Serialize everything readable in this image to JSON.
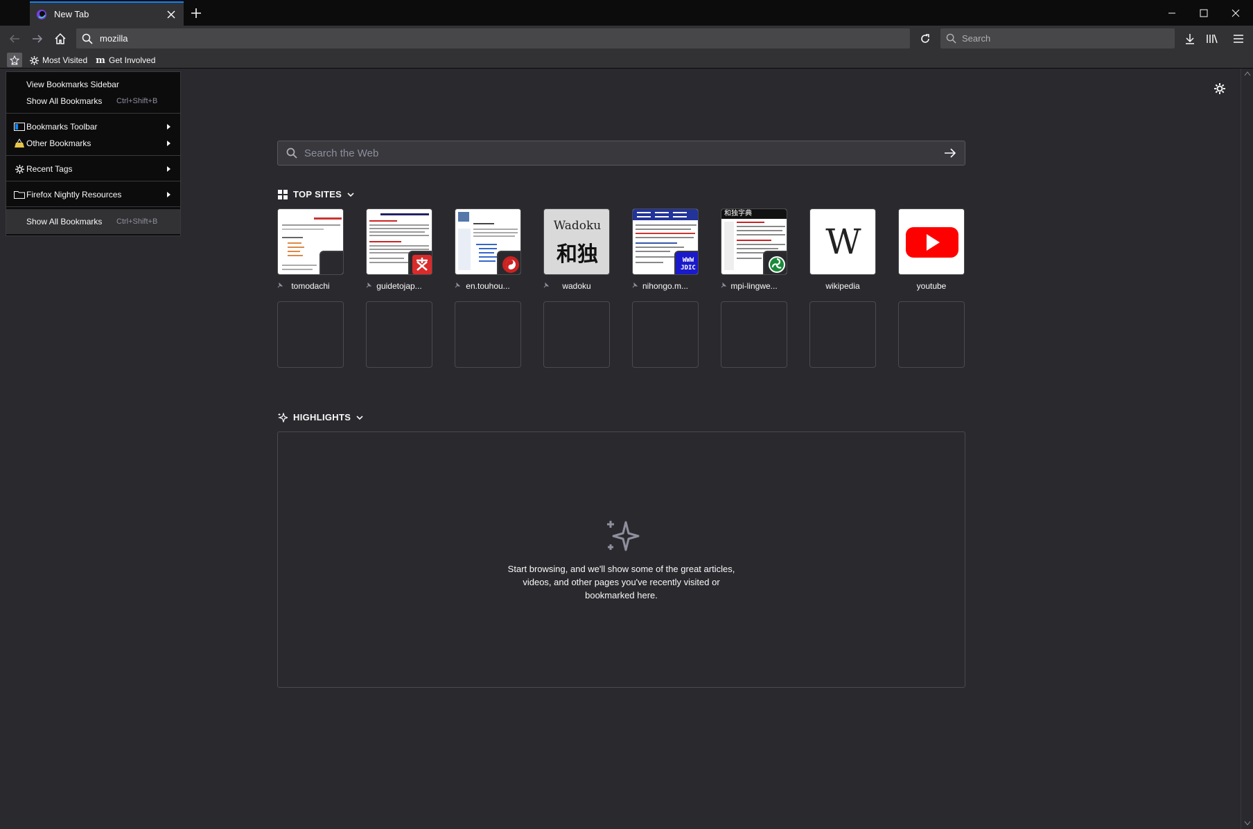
{
  "tab": {
    "title": "New Tab"
  },
  "urlbar": {
    "value": "mozilla"
  },
  "searchbar": {
    "placeholder": "Search"
  },
  "bookmarks_toolbar": {
    "items": [
      {
        "label": "Most Visited",
        "icon": "gear-icon"
      },
      {
        "label": "Get Involved",
        "icon": "mozilla-m-icon"
      }
    ]
  },
  "bookmarks_menu": {
    "view_sidebar": "View Bookmarks Sidebar",
    "show_all_top": "Show All Bookmarks",
    "show_all_top_shortcut": "Ctrl+Shift+B",
    "bookmarks_toolbar": "Bookmarks Toolbar",
    "other_bookmarks": "Other Bookmarks",
    "recent_tags": "Recent Tags",
    "firefox_nightly_resources": "Firefox Nightly Resources",
    "show_all_bottom": "Show All Bookmarks",
    "show_all_bottom_shortcut": "Ctrl+Shift+B"
  },
  "newtab": {
    "search_placeholder": "Search the Web",
    "top_sites_title": "TOP SITES",
    "highlights_title": "HIGHLIGHTS",
    "highlights_empty": "Start browsing, and we'll show some of the great articles, videos, and other pages you've recently visited or bookmarked here.",
    "top_sites": [
      {
        "label": "tomodachi",
        "pinned": true
      },
      {
        "label": "guidetojap...",
        "pinned": true
      },
      {
        "label": "en.touhou...",
        "pinned": true
      },
      {
        "label": "wadoku",
        "pinned": true,
        "thumb_text": "Wadoku",
        "thumb_kanji": "和独"
      },
      {
        "label": "nihongo.m...",
        "pinned": true,
        "badge_text": "WWW JDIC"
      },
      {
        "label": "mpi-lingwe...",
        "pinned": true,
        "thumb_text": "和独字典"
      },
      {
        "label": "wikipedia",
        "pinned": false,
        "thumb_text": "W"
      },
      {
        "label": "youtube",
        "pinned": false
      }
    ]
  },
  "colors": {
    "accent": "#0a84ff",
    "background": "#2a2a2e",
    "toolbar": "#323234",
    "youtube_red": "#ff0000"
  }
}
